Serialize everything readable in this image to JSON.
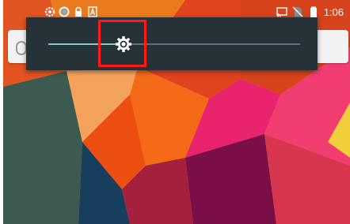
{
  "status_bar": {
    "time": "1:06",
    "left_icons": [
      "settings-gear-icon",
      "circle-icon",
      "lock-icon",
      "a-badge-icon"
    ],
    "right_icons": [
      "cast-icon",
      "no-sim-icon",
      "battery-icon"
    ]
  },
  "brightness": {
    "level": 0.3
  },
  "colors": {
    "panel": "#263238",
    "slider_fill": "#80cbc4",
    "slider_track": "#5f7278",
    "highlight": "#ff1a1a"
  }
}
